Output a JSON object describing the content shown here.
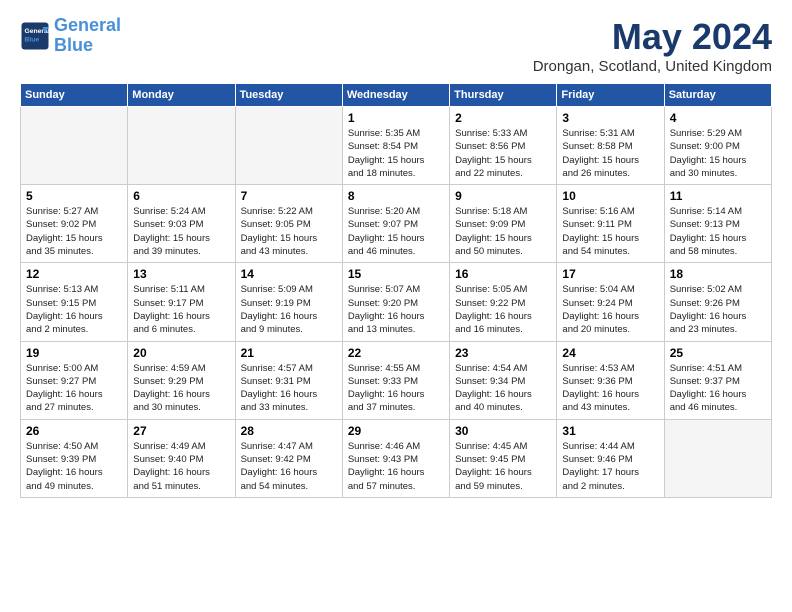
{
  "logo": {
    "line1": "General",
    "line2": "Blue"
  },
  "title": "May 2024",
  "subtitle": "Drongan, Scotland, United Kingdom",
  "days_header": [
    "Sunday",
    "Monday",
    "Tuesday",
    "Wednesday",
    "Thursday",
    "Friday",
    "Saturday"
  ],
  "weeks": [
    [
      {
        "day": "",
        "info": "",
        "empty": true
      },
      {
        "day": "",
        "info": "",
        "empty": true
      },
      {
        "day": "",
        "info": "",
        "empty": true
      },
      {
        "day": "1",
        "info": "Sunrise: 5:35 AM\nSunset: 8:54 PM\nDaylight: 15 hours\nand 18 minutes."
      },
      {
        "day": "2",
        "info": "Sunrise: 5:33 AM\nSunset: 8:56 PM\nDaylight: 15 hours\nand 22 minutes."
      },
      {
        "day": "3",
        "info": "Sunrise: 5:31 AM\nSunset: 8:58 PM\nDaylight: 15 hours\nand 26 minutes."
      },
      {
        "day": "4",
        "info": "Sunrise: 5:29 AM\nSunset: 9:00 PM\nDaylight: 15 hours\nand 30 minutes."
      }
    ],
    [
      {
        "day": "5",
        "info": "Sunrise: 5:27 AM\nSunset: 9:02 PM\nDaylight: 15 hours\nand 35 minutes."
      },
      {
        "day": "6",
        "info": "Sunrise: 5:24 AM\nSunset: 9:03 PM\nDaylight: 15 hours\nand 39 minutes."
      },
      {
        "day": "7",
        "info": "Sunrise: 5:22 AM\nSunset: 9:05 PM\nDaylight: 15 hours\nand 43 minutes."
      },
      {
        "day": "8",
        "info": "Sunrise: 5:20 AM\nSunset: 9:07 PM\nDaylight: 15 hours\nand 46 minutes."
      },
      {
        "day": "9",
        "info": "Sunrise: 5:18 AM\nSunset: 9:09 PM\nDaylight: 15 hours\nand 50 minutes."
      },
      {
        "day": "10",
        "info": "Sunrise: 5:16 AM\nSunset: 9:11 PM\nDaylight: 15 hours\nand 54 minutes."
      },
      {
        "day": "11",
        "info": "Sunrise: 5:14 AM\nSunset: 9:13 PM\nDaylight: 15 hours\nand 58 minutes."
      }
    ],
    [
      {
        "day": "12",
        "info": "Sunrise: 5:13 AM\nSunset: 9:15 PM\nDaylight: 16 hours\nand 2 minutes."
      },
      {
        "day": "13",
        "info": "Sunrise: 5:11 AM\nSunset: 9:17 PM\nDaylight: 16 hours\nand 6 minutes."
      },
      {
        "day": "14",
        "info": "Sunrise: 5:09 AM\nSunset: 9:19 PM\nDaylight: 16 hours\nand 9 minutes."
      },
      {
        "day": "15",
        "info": "Sunrise: 5:07 AM\nSunset: 9:20 PM\nDaylight: 16 hours\nand 13 minutes."
      },
      {
        "day": "16",
        "info": "Sunrise: 5:05 AM\nSunset: 9:22 PM\nDaylight: 16 hours\nand 16 minutes."
      },
      {
        "day": "17",
        "info": "Sunrise: 5:04 AM\nSunset: 9:24 PM\nDaylight: 16 hours\nand 20 minutes."
      },
      {
        "day": "18",
        "info": "Sunrise: 5:02 AM\nSunset: 9:26 PM\nDaylight: 16 hours\nand 23 minutes."
      }
    ],
    [
      {
        "day": "19",
        "info": "Sunrise: 5:00 AM\nSunset: 9:27 PM\nDaylight: 16 hours\nand 27 minutes."
      },
      {
        "day": "20",
        "info": "Sunrise: 4:59 AM\nSunset: 9:29 PM\nDaylight: 16 hours\nand 30 minutes."
      },
      {
        "day": "21",
        "info": "Sunrise: 4:57 AM\nSunset: 9:31 PM\nDaylight: 16 hours\nand 33 minutes."
      },
      {
        "day": "22",
        "info": "Sunrise: 4:55 AM\nSunset: 9:33 PM\nDaylight: 16 hours\nand 37 minutes."
      },
      {
        "day": "23",
        "info": "Sunrise: 4:54 AM\nSunset: 9:34 PM\nDaylight: 16 hours\nand 40 minutes."
      },
      {
        "day": "24",
        "info": "Sunrise: 4:53 AM\nSunset: 9:36 PM\nDaylight: 16 hours\nand 43 minutes."
      },
      {
        "day": "25",
        "info": "Sunrise: 4:51 AM\nSunset: 9:37 PM\nDaylight: 16 hours\nand 46 minutes."
      }
    ],
    [
      {
        "day": "26",
        "info": "Sunrise: 4:50 AM\nSunset: 9:39 PM\nDaylight: 16 hours\nand 49 minutes."
      },
      {
        "day": "27",
        "info": "Sunrise: 4:49 AM\nSunset: 9:40 PM\nDaylight: 16 hours\nand 51 minutes."
      },
      {
        "day": "28",
        "info": "Sunrise: 4:47 AM\nSunset: 9:42 PM\nDaylight: 16 hours\nand 54 minutes."
      },
      {
        "day": "29",
        "info": "Sunrise: 4:46 AM\nSunset: 9:43 PM\nDaylight: 16 hours\nand 57 minutes."
      },
      {
        "day": "30",
        "info": "Sunrise: 4:45 AM\nSunset: 9:45 PM\nDaylight: 16 hours\nand 59 minutes."
      },
      {
        "day": "31",
        "info": "Sunrise: 4:44 AM\nSunset: 9:46 PM\nDaylight: 17 hours\nand 2 minutes."
      },
      {
        "day": "",
        "info": "",
        "empty": true
      }
    ]
  ]
}
